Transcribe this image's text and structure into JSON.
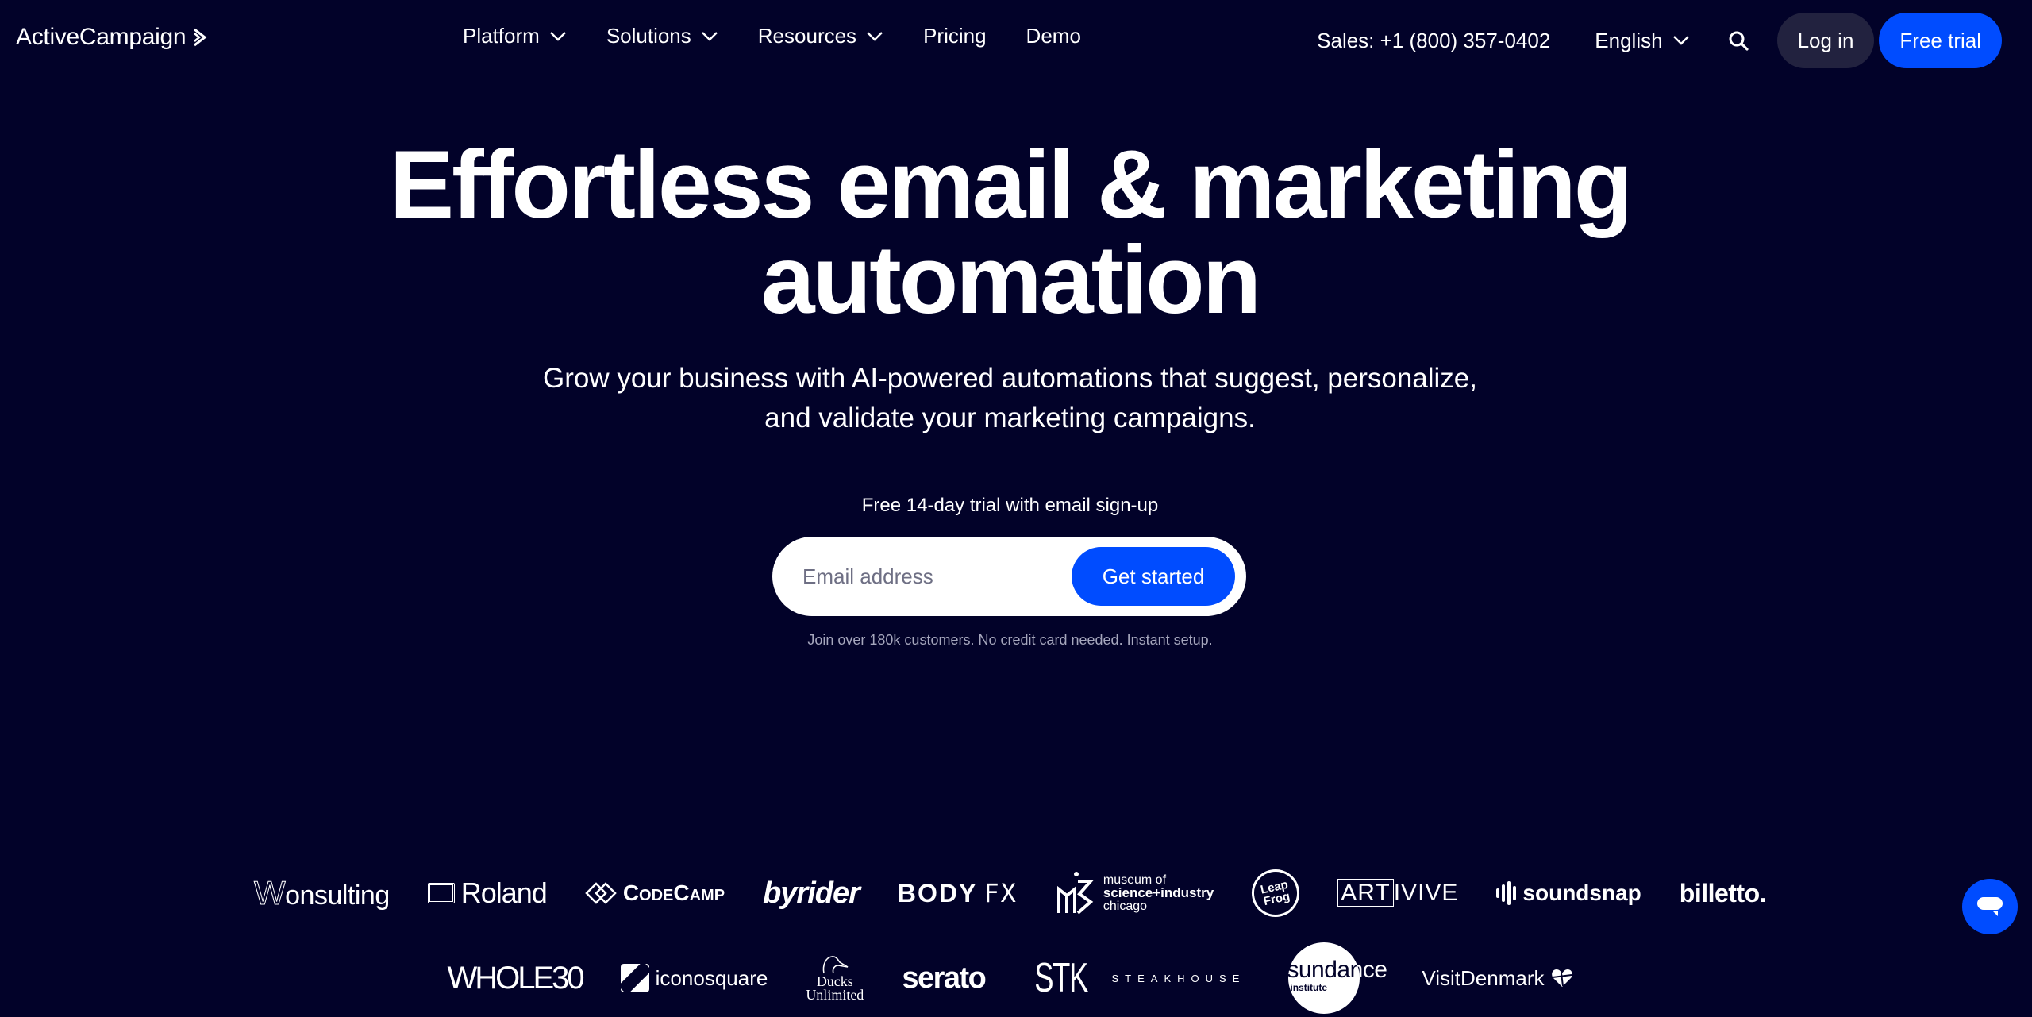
{
  "header": {
    "brand": "ActiveCampaign",
    "nav": [
      {
        "label": "Platform",
        "dropdown": true
      },
      {
        "label": "Solutions",
        "dropdown": true
      },
      {
        "label": "Resources",
        "dropdown": true
      },
      {
        "label": "Pricing",
        "dropdown": false
      },
      {
        "label": "Demo",
        "dropdown": false
      }
    ],
    "sales": "Sales: +1 (800) 357-0402",
    "language": "English",
    "search_icon": "search-icon",
    "login_label": "Log in",
    "free_trial_label": "Free trial"
  },
  "hero": {
    "title_line1": "Effortless email & marketing",
    "title_line2": "automation",
    "subtitle_line1": "Grow your business with AI-powered automations that suggest, personalize,",
    "subtitle_line2": "and validate your marketing campaigns.",
    "trial_note": "Free 14-day trial with email sign-up",
    "email_placeholder": "Email address",
    "email_value": "",
    "cta_label": "Get started",
    "fine_print": "Join over 180k customers. No credit card needed. Instant setup."
  },
  "logos": {
    "row1": {
      "wonsulting": {
        "mark": "W",
        "text": "onsulting"
      },
      "roland": "Roland",
      "codecamp": "CodeCamp",
      "byrider": "byrider",
      "bodyfx": {
        "body": "BODY",
        "fx": "FX"
      },
      "msi": {
        "line1": "museum of",
        "line2": "science+industry",
        "line3": "chicago"
      },
      "leapfrog": {
        "line1": "Leap",
        "line2": "Frog"
      },
      "artivive": {
        "boxed": "ART",
        "rest": "IVIVE"
      },
      "soundsnap": "soundsnap",
      "billetto": "billetto."
    },
    "row2": {
      "whole30": "WHOLE30",
      "iconosquare": "iconosquare",
      "ducks": {
        "line1": "Ducks",
        "line2": "Unlimited"
      },
      "serato": "serato",
      "stk": {
        "mark": "STK",
        "sub": "STEAKHOUSE"
      },
      "sundance": {
        "name": "sundance",
        "sub": "institute"
      },
      "visitdenmark": "VisitDenmark"
    }
  },
  "chat": {
    "icon": "chat-bubble-icon"
  },
  "colors": {
    "background": "#020229",
    "primary": "#004cff",
    "login_bg": "#22223f",
    "muted_text": "#a6a7bd"
  }
}
